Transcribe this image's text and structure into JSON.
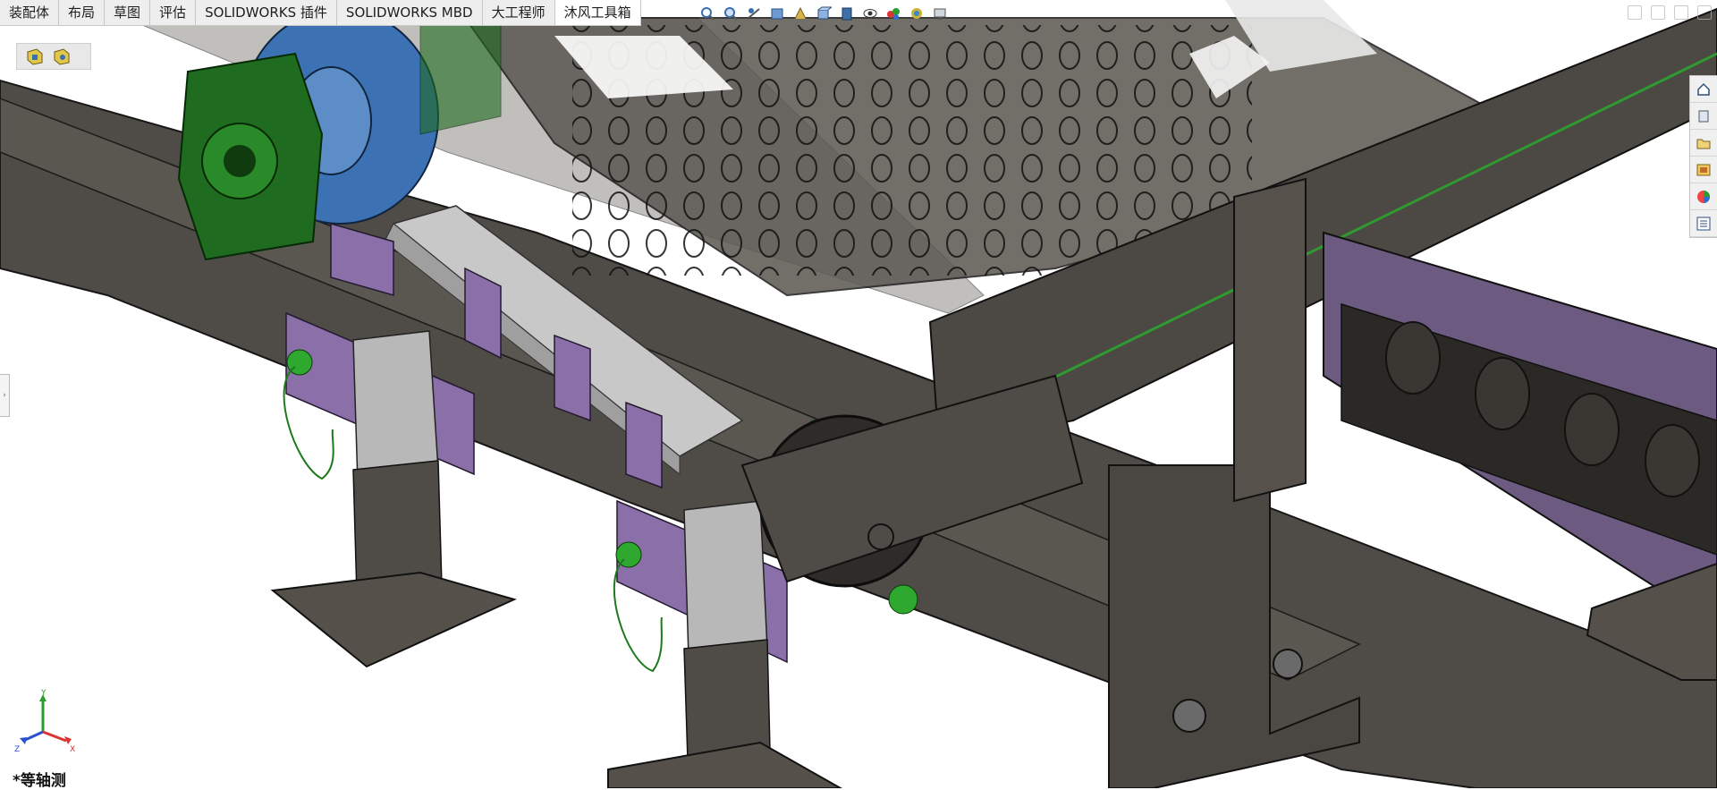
{
  "tabs": [
    {
      "label": "装配体",
      "active": false
    },
    {
      "label": "布局",
      "active": false
    },
    {
      "label": "草图",
      "active": false
    },
    {
      "label": "评估",
      "active": false
    },
    {
      "label": "SOLIDWORKS 插件",
      "active": false
    },
    {
      "label": "SOLIDWORKS MBD",
      "active": false
    },
    {
      "label": "大工程师",
      "active": false
    },
    {
      "label": "沐风工具箱",
      "active": true
    }
  ],
  "heads_up_toolbar": [
    "zoom-to-fit-icon",
    "zoom-to-area-icon",
    "previous-view-icon",
    "section-view-icon",
    "dynamic-annotation-icon",
    "view-orientation-icon",
    "display-style-icon",
    "hide-show-items-icon",
    "edit-appearance-icon",
    "apply-scene-icon",
    "view-settings-icon"
  ],
  "task_pane": [
    "solidworks-resources-icon",
    "design-library-icon",
    "file-explorer-icon",
    "view-palette-icon",
    "appearances-icon",
    "custom-properties-icon"
  ],
  "view": {
    "orientation_label": "*等轴测",
    "triad": {
      "x": "X",
      "y": "Y",
      "z": "Z"
    }
  },
  "colors": {
    "frame_dark": "#4f4b46",
    "frame_edge": "#1a1a1a",
    "bracket_purple": "#8a6fa8",
    "bearing_green": "#1f6b1f",
    "motor_blue": "#3c72b4",
    "aluminum": "#b8b8b8",
    "background": "#ffffff"
  }
}
